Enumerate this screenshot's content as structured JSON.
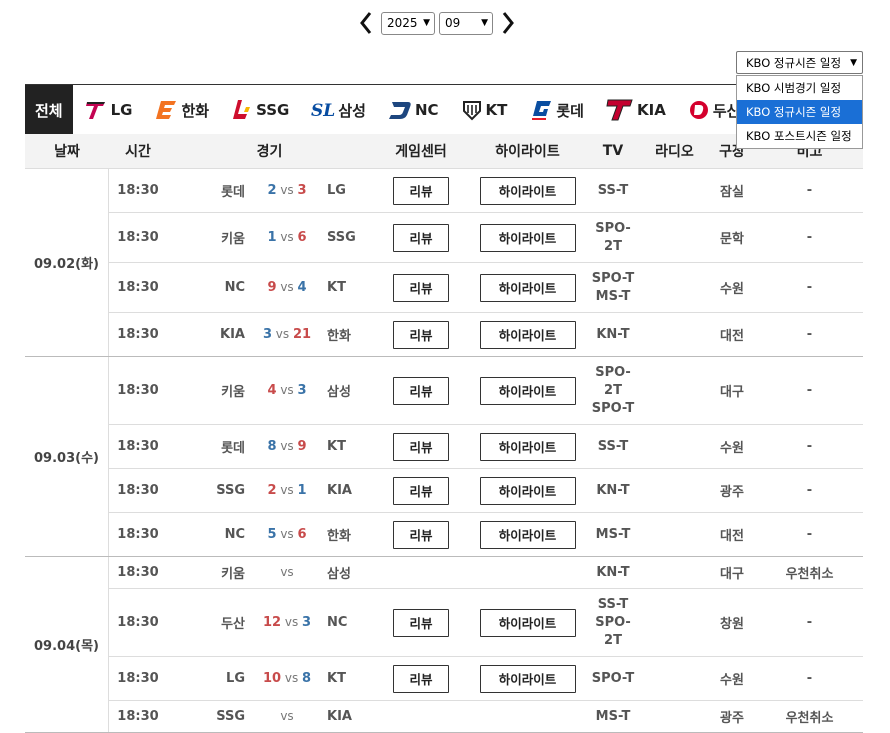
{
  "nav": {
    "year": "2025",
    "month": "09"
  },
  "season": {
    "selected": "KBO 정규시즌 일정",
    "options": [
      "KBO 시범경기 일정",
      "KBO 정규시즌 일정",
      "KBO 포스트시즌 일정"
    ]
  },
  "tabs": [
    "전체",
    "LG",
    "한화",
    "SSG",
    "삼성",
    "NC",
    "KT",
    "롯데",
    "KIA",
    "두산"
  ],
  "headers": [
    "날짜",
    "시간",
    "경기",
    "게임센터",
    "하이라이트",
    "TV",
    "라디오",
    "구장",
    "비고"
  ],
  "buttons": {
    "review": "리뷰",
    "highlight": "하이라이트"
  },
  "colors": {
    "win": "#c84b4b",
    "lose": "#3a73a8",
    "tab_active_bg": "#222222",
    "menu_active": "#1a6fd6"
  },
  "days": [
    {
      "date": "09.02(화)",
      "games": [
        {
          "time": "18:30",
          "away": "롯데",
          "as": "2",
          "hs": "3",
          "home": "LG",
          "tv": [
            "SS-T"
          ],
          "park": "잠실",
          "note": "-",
          "played": true
        },
        {
          "time": "18:30",
          "away": "키움",
          "as": "1",
          "hs": "6",
          "home": "SSG",
          "tv": [
            "SPO-",
            "2T"
          ],
          "park": "문학",
          "note": "-",
          "played": true
        },
        {
          "time": "18:30",
          "away": "NC",
          "as": "9",
          "hs": "4",
          "home": "KT",
          "tv": [
            "SPO-T",
            "MS-T"
          ],
          "park": "수원",
          "note": "-",
          "played": true
        },
        {
          "time": "18:30",
          "away": "KIA",
          "as": "3",
          "hs": "21",
          "home": "한화",
          "tv": [
            "KN-T"
          ],
          "park": "대전",
          "note": "-",
          "played": true
        }
      ]
    },
    {
      "date": "09.03(수)",
      "games": [
        {
          "time": "18:30",
          "away": "키움",
          "as": "4",
          "hs": "3",
          "home": "삼성",
          "tv": [
            "SPO-",
            "2T",
            "SPO-T"
          ],
          "park": "대구",
          "note": "-",
          "played": true
        },
        {
          "time": "18:30",
          "away": "롯데",
          "as": "8",
          "hs": "9",
          "home": "KT",
          "tv": [
            "SS-T"
          ],
          "park": "수원",
          "note": "-",
          "played": true
        },
        {
          "time": "18:30",
          "away": "SSG",
          "as": "2",
          "hs": "1",
          "home": "KIA",
          "tv": [
            "KN-T"
          ],
          "park": "광주",
          "note": "-",
          "played": true
        },
        {
          "time": "18:30",
          "away": "NC",
          "as": "5",
          "hs": "6",
          "home": "한화",
          "tv": [
            "MS-T"
          ],
          "park": "대전",
          "note": "-",
          "played": true
        }
      ]
    },
    {
      "date": "09.04(목)",
      "games": [
        {
          "time": "18:30",
          "away": "키움",
          "as": "",
          "hs": "",
          "home": "삼성",
          "tv": [
            "KN-T"
          ],
          "park": "대구",
          "note": "우천취소",
          "played": false
        },
        {
          "time": "18:30",
          "away": "두산",
          "as": "12",
          "hs": "3",
          "home": "NC",
          "tv": [
            "SS-T",
            "SPO-",
            "2T"
          ],
          "park": "창원",
          "note": "-",
          "played": true
        },
        {
          "time": "18:30",
          "away": "LG",
          "as": "10",
          "hs": "8",
          "home": "KT",
          "tv": [
            "SPO-T"
          ],
          "park": "수원",
          "note": "-",
          "played": true
        },
        {
          "time": "18:30",
          "away": "SSG",
          "as": "",
          "hs": "",
          "home": "KIA",
          "tv": [
            "MS-T"
          ],
          "park": "광주",
          "note": "우천취소",
          "played": false
        }
      ]
    }
  ]
}
